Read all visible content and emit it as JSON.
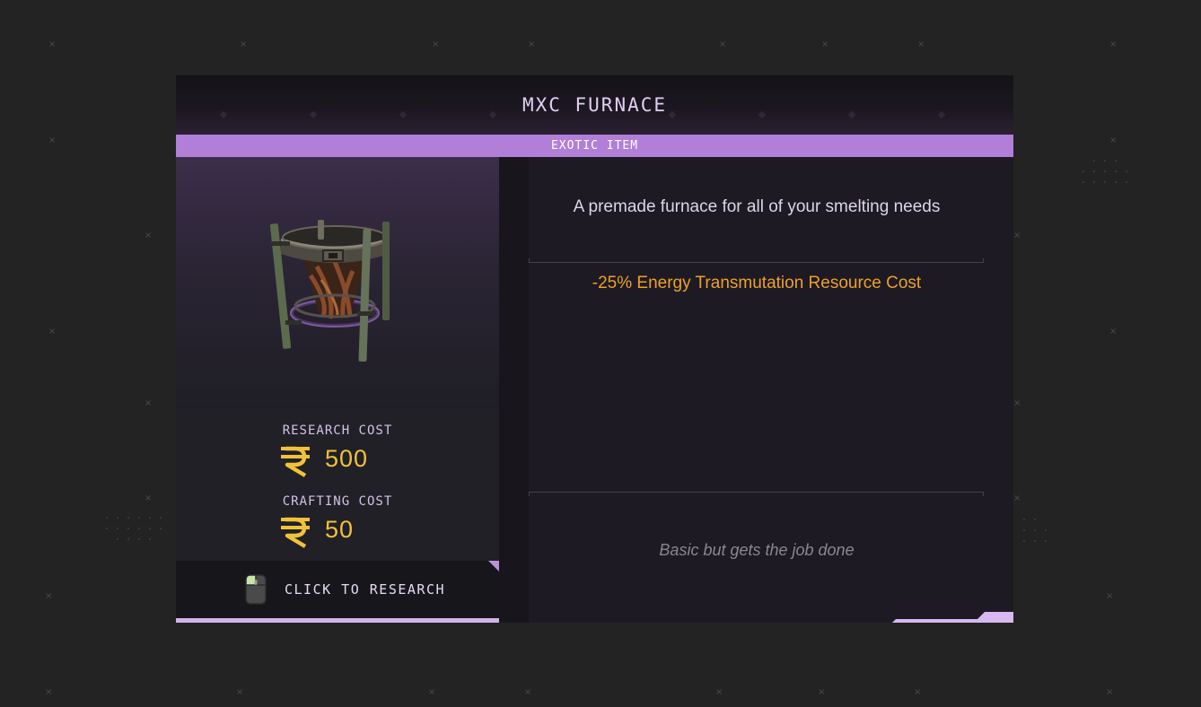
{
  "item": {
    "title": "MXC FURNACE",
    "rarity": "EXOTIC ITEM",
    "description": "A premade furnace for all of your smelting needs",
    "stat": "-25% Energy Transmutation Resource Cost",
    "flavor": "Basic but gets the job done"
  },
  "costs": {
    "research_label": "RESEARCH COST",
    "research_value": "500",
    "crafting_label": "CRAFTING COST",
    "crafting_value": "50",
    "currency_icon": "rupee-currency-icon"
  },
  "action": {
    "research_label": "CLICK TO RESEARCH",
    "icon": "mouse-left-click-icon"
  },
  "colors": {
    "rarity": "#b17fd7",
    "stat": "#eda12a",
    "cost": "#f0c23a"
  }
}
